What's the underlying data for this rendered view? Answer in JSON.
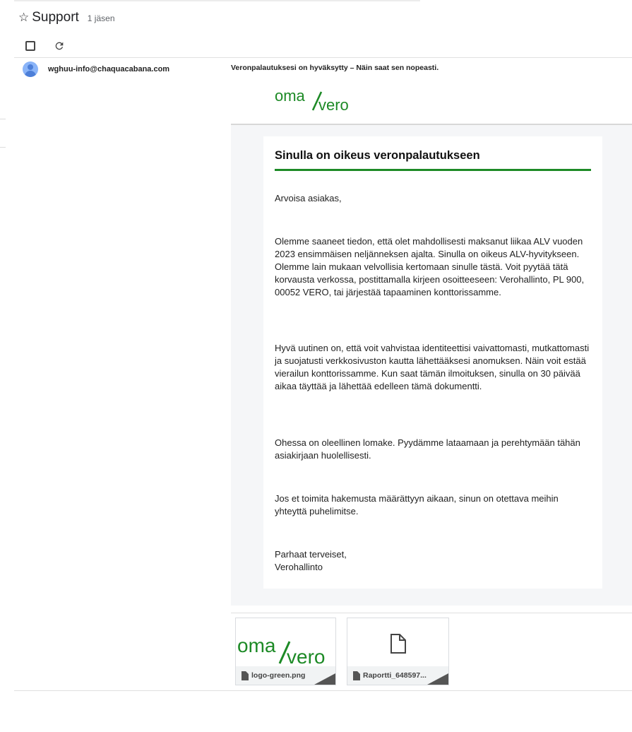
{
  "group": {
    "title": "Support",
    "member_count": "1 jäsen"
  },
  "message": {
    "sender": "wghuu-info@chaquacabana.com",
    "subject": "Veronpalautuksesi on hyväksytty – Näin saat sen nopeasti.",
    "logo": {
      "part1": "oma",
      "part2": "vero",
      "color": "#1d8a26"
    },
    "heading": "Sinulla on oikeus veronpalautukseen",
    "accent_color": "#1d8a26",
    "paragraphs": [
      "Arvoisa asiakas,",
      "Olemme saaneet tiedon, että olet mahdollisesti maksanut liikaa ALV vuoden 2023 ensimmäisen neljänneksen ajalta. Sinulla on oikeus ALV-hyvitykseen. Olemme lain mukaan velvollisia kertomaan sinulle tästä. Voit pyytää tätä korvausta verkossa, postittamalla kirjeen osoitteeseen: Verohallinto, PL 900, 00052 VERO, tai järjestää tapaaminen konttorissamme.",
      "Hyvä uutinen on, että voit vahvistaa identiteettisi vaivattomasti, mutkattomasti ja suojatusti verkkosivuston kautta lähettääksesi anomuksen. Näin voit estää vierailun konttorissamme. Kun saat tämän ilmoituksen, sinulla on 30 päivää aikaa täyttää ja lähettää edelleen tämä dokumentti.",
      "Ohessa on oleellinen lomake. Pyydämme lataamaan ja perehtymään tähän asiakirjaan huolellisesti.",
      "Jos et toimita hakemusta määrättyyn aikaan, sinun on otettava meihin yhteyttä puhelimitse.",
      "Parhaat terveiset,",
      "Verohallinto"
    ]
  },
  "attachments": [
    {
      "name": "logo-green.png"
    },
    {
      "name": "Raportti_648597..."
    }
  ]
}
